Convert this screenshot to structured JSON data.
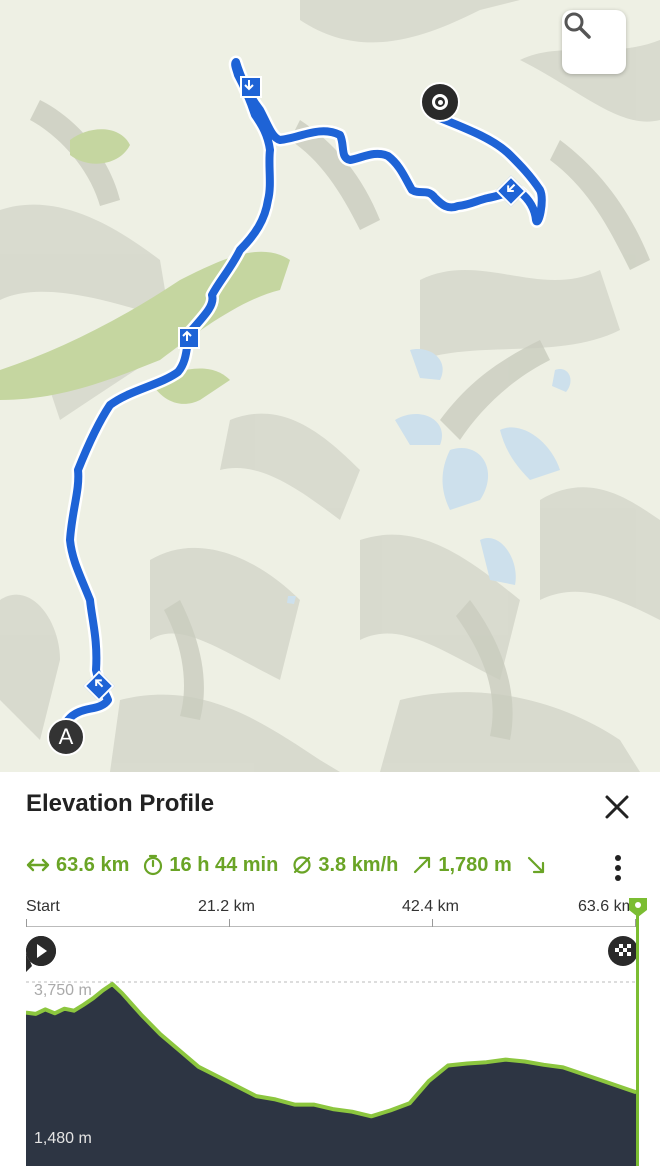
{
  "map": {
    "marker_start_label": "A",
    "route_color": "#1e63d6"
  },
  "sheet": {
    "title": "Elevation Profile",
    "stats": {
      "distance": "63.6 km",
      "duration": "16 h 44 min",
      "avg_speed": "3.8 km/h",
      "ascent": "1,780 m"
    },
    "axis_labels": [
      "Start",
      "21.2 km",
      "42.4 km",
      "63.6 km"
    ],
    "elevation_max_label": "3,750 m",
    "elevation_min_label": "1,480 m",
    "accent_color": "#6aa426"
  },
  "chart_data": {
    "type": "area",
    "xlabel": "",
    "ylabel": "",
    "x_ticks": [
      "Start",
      "21.2 km",
      "42.4 km",
      "63.6 km"
    ],
    "xlim": [
      0,
      63.6
    ],
    "ylim": [
      1480,
      3750
    ],
    "x": [
      0,
      1,
      2,
      3,
      4,
      5,
      6,
      7,
      8,
      9,
      10,
      12,
      14,
      16,
      18,
      20,
      22,
      24,
      26,
      28,
      30,
      32,
      34,
      36,
      38,
      40,
      42,
      44,
      46,
      48,
      50,
      52,
      54,
      56,
      58,
      60,
      62,
      63.6
    ],
    "y": [
      3280,
      3260,
      3330,
      3270,
      3340,
      3310,
      3400,
      3500,
      3620,
      3720,
      3580,
      3250,
      2950,
      2700,
      2450,
      2300,
      2150,
      2000,
      1950,
      1870,
      1870,
      1800,
      1760,
      1690,
      1780,
      1890,
      2230,
      2470,
      2500,
      2520,
      2560,
      2530,
      2480,
      2440,
      2340,
      2240,
      2140,
      2060
    ]
  }
}
